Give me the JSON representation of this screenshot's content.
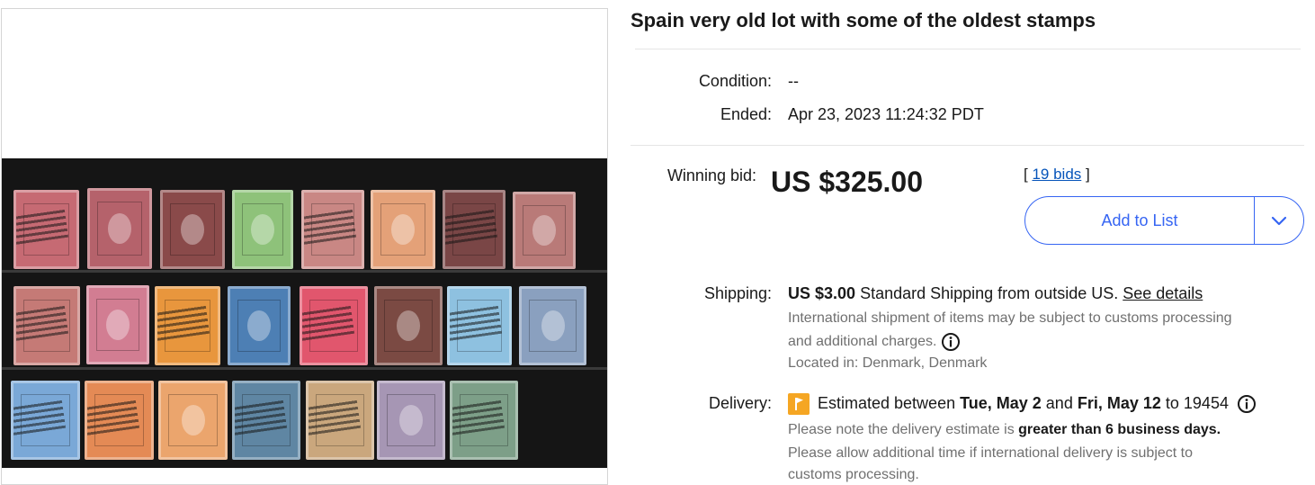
{
  "listing": {
    "title": "Spain very old lot with some of the oldest stamps",
    "condition_label": "Condition:",
    "condition_value": "--",
    "ended_label": "Ended:",
    "ended_value": "Apr 23, 2023 11:24:32 PDT"
  },
  "bid": {
    "label": "Winning bid:",
    "price": "US $325.00",
    "bids_open": "[ ",
    "bids_link": "19 bids",
    "bids_close": " ]",
    "add_to_list": "Add to List"
  },
  "shipping": {
    "label": "Shipping:",
    "price": "US $3.00",
    "method": " Standard Shipping from outside US. ",
    "see_details": "See details",
    "note_line1": "International shipment of items may be subject to customs processing",
    "note_line2": "and additional charges.",
    "located": "Located in: Denmark, Denmark"
  },
  "delivery": {
    "label": "Delivery:",
    "text1": "Estimated between ",
    "date1": "Tue, May 2",
    "text2": " and ",
    "date2": "Fri, May 12",
    "text3": " to ",
    "zip": "19454",
    "note1_pre": "Please note the delivery estimate is ",
    "note1_bold": "greater than 6 business days.",
    "note2_line1": "Please allow additional time if international delivery is subject to",
    "note2_line2": "customs processing."
  },
  "colors": {
    "accent": "#3665f3",
    "link": "#0654ba",
    "flag": "#f5a623"
  },
  "icons": {
    "info": "info-circle-icon",
    "chevron": "chevron-down-icon",
    "flag": "flag-icon"
  }
}
